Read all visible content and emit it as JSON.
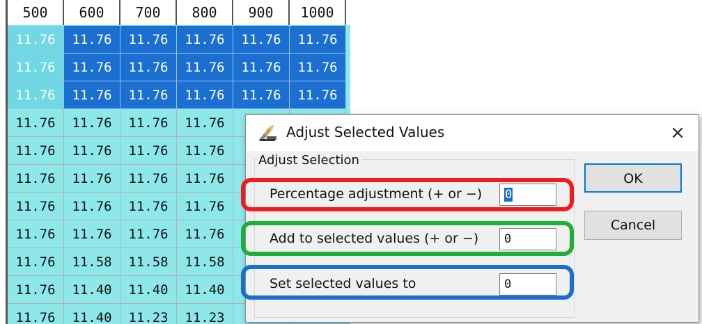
{
  "grid": {
    "columns": [
      "500",
      "600",
      "700",
      "800",
      "900",
      "1000"
    ],
    "rows": [
      {
        "selected": true,
        "values": [
          "11.76",
          "11.76",
          "11.76",
          "11.76",
          "11.76",
          "11.76"
        ]
      },
      {
        "selected": true,
        "values": [
          "11.76",
          "11.76",
          "11.76",
          "11.76",
          "11.76",
          "11.76"
        ]
      },
      {
        "selected": true,
        "values": [
          "11.76",
          "11.76",
          "11.76",
          "11.76",
          "11.76",
          "11.76"
        ]
      },
      {
        "selected": false,
        "values": [
          "11.76",
          "11.76",
          "11.76",
          "11.76",
          "",
          ""
        ]
      },
      {
        "selected": false,
        "values": [
          "11.76",
          "11.76",
          "11.76",
          "11.76",
          "",
          ""
        ]
      },
      {
        "selected": false,
        "values": [
          "11.76",
          "11.76",
          "11.76",
          "11.76",
          "",
          ""
        ]
      },
      {
        "selected": false,
        "values": [
          "11.76",
          "11.76",
          "11.76",
          "11.76",
          "",
          ""
        ]
      },
      {
        "selected": false,
        "values": [
          "11.76",
          "11.76",
          "11.76",
          "11.76",
          "",
          ""
        ]
      },
      {
        "selected": false,
        "values": [
          "11.76",
          "11.58",
          "11.58",
          "11.58",
          "",
          ""
        ]
      },
      {
        "selected": false,
        "values": [
          "11.76",
          "11.40",
          "11.40",
          "11.40",
          "",
          ""
        ]
      },
      {
        "selected": false,
        "values": [
          "11.76",
          "11.40",
          "11.23",
          "11.23",
          "",
          ""
        ]
      }
    ],
    "colors": {
      "cell_bg": "#8ee8ea",
      "selected_bg": "#1b6fd0"
    }
  },
  "dialog": {
    "title": "Adjust Selected Values",
    "close_glyph": "×",
    "group_label": "Adjust Selection",
    "fields": {
      "percentage": {
        "label": "Percentage adjustment (+ or −)",
        "value": "0"
      },
      "add": {
        "label": "Add to selected values (+ or −)",
        "value": "0"
      },
      "set": {
        "label": "Set selected values to",
        "value": "0"
      }
    },
    "ok_label": "OK",
    "cancel_label": "Cancel",
    "icon": "adjust-tool-icon",
    "highlight_colors": {
      "red": "#ee1c1c",
      "green": "#1fae3a",
      "blue": "#1a6fc8"
    }
  }
}
